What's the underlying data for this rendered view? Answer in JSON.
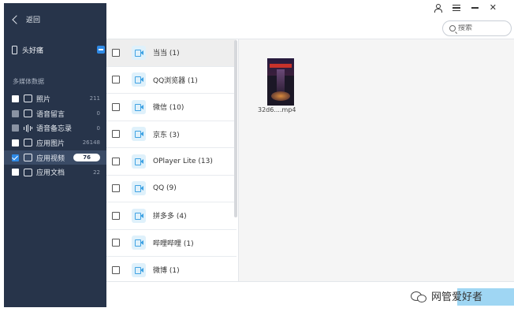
{
  "sidebar": {
    "back_label": "返回",
    "device_name": "头好痛",
    "section_title": "多媒体数据",
    "categories": [
      {
        "label": "照片",
        "count": "211",
        "icon": "photo-icon"
      },
      {
        "label": "语音留言",
        "count": "0",
        "icon": "voicemail-icon"
      },
      {
        "label": "语音备忘录",
        "count": "0",
        "icon": "voice-memo-icon"
      },
      {
        "label": "应用图片",
        "count": "26148",
        "icon": "app-photo-icon"
      },
      {
        "label": "应用视频",
        "count": "76",
        "icon": "app-video-icon"
      },
      {
        "label": "应用文档",
        "count": "22",
        "icon": "app-doc-icon"
      }
    ]
  },
  "search": {
    "placeholder": "搜索"
  },
  "apps": [
    {
      "label": "当当 (1)"
    },
    {
      "label": "QQ浏览器 (1)"
    },
    {
      "label": "微信 (10)"
    },
    {
      "label": "京东 (3)"
    },
    {
      "label": "OPlayer Lite (13)"
    },
    {
      "label": "QQ (9)"
    },
    {
      "label": "拼多多 (4)"
    },
    {
      "label": "哔哩哔哩 (1)"
    },
    {
      "label": "微博 (1)"
    }
  ],
  "preview": {
    "file_name": "32d6....mp4"
  },
  "watermark": {
    "text": "网管爱好者"
  },
  "colors": {
    "sidebar_bg": "#27344a",
    "accent": "#2f8ae6",
    "video_icon": "#3fa2e3"
  }
}
